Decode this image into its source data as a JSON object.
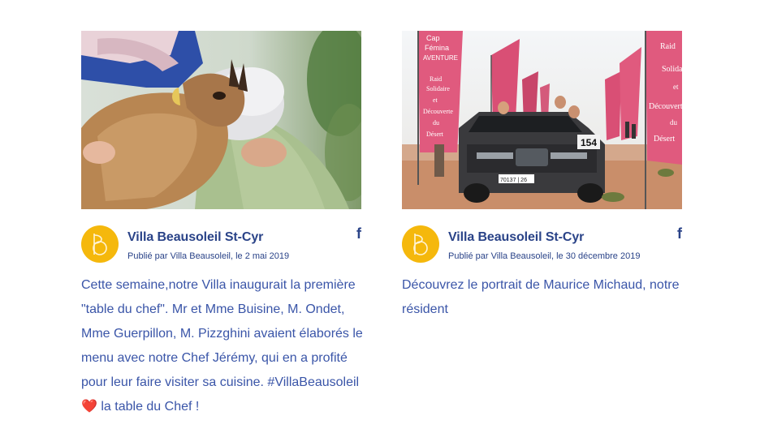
{
  "colors": {
    "accent": "#2a4388",
    "text": "#3a55a8",
    "avatar": "#f5b80c",
    "heart": "#e0192e"
  },
  "posts": [
    {
      "image_alt": "Chèvre dans les bras d'une résidente",
      "author": "Villa Beausoleil St-Cyr",
      "date_line": "Publié par Villa Beausoleil, le 2 mai 2019",
      "share_icon": "facebook-icon",
      "share_glyph": "f",
      "body_before": "Cette semaine,notre Villa inaugurait la première \"table du chef\". Mr et Mme Buisine, M. Ondet, Mme Guerpillon, M. Pizzghini avaient élaborés le menu avec notre Chef Jérémy, qui en a profité pour leur faire visiter sa cuisine. #VillaBeausoleil ",
      "body_emoji": "❤️",
      "body_after": " la table du Chef !"
    },
    {
      "image_alt": "4x4 devant des drapeaux Cap Fémina Aventure dans le désert",
      "author": "Villa Beausoleil St-Cyr",
      "date_line": "Publié par Villa Beausoleil, le 30 décembre 2019",
      "share_icon": "facebook-icon",
      "share_glyph": "f",
      "body_before": "Découvrez le portrait de Maurice Michaud, notre résident",
      "body_emoji": "",
      "body_after": ""
    }
  ],
  "photo_text": {
    "flag_words": [
      "Cap",
      "Fémina",
      "AVENTURE",
      "Raid",
      "Solidaire",
      "et",
      "Découverte",
      "du",
      "Désert"
    ],
    "plate": "70137 | 26",
    "number": "154"
  }
}
